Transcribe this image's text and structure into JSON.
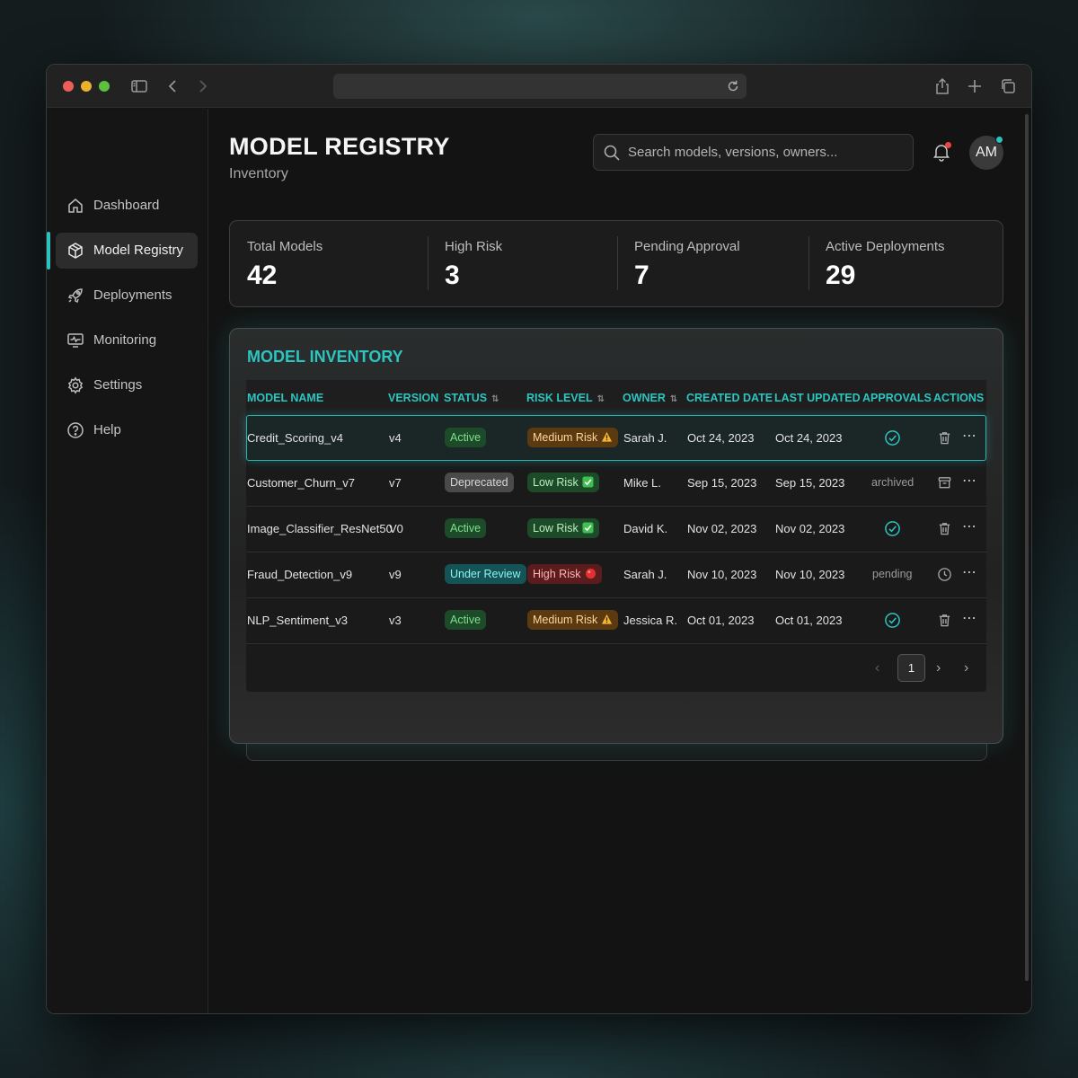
{
  "header": {
    "title": "MODEL REGISTRY",
    "subtitle": "Inventory"
  },
  "search": {
    "placeholder": "Search models, versions, owners..."
  },
  "user": {
    "initials": "AM"
  },
  "sidebar": {
    "items": [
      {
        "label": "Dashboard",
        "icon": "home-icon"
      },
      {
        "label": "Model Registry",
        "icon": "cube-icon",
        "active": true
      },
      {
        "label": "Deployments",
        "icon": "rocket-icon"
      },
      {
        "label": "Monitoring",
        "icon": "monitor-icon"
      },
      {
        "label": "Settings",
        "icon": "gear-icon"
      },
      {
        "label": "Help",
        "icon": "help-icon"
      }
    ]
  },
  "stats": [
    {
      "label": "Total Models",
      "value": "42"
    },
    {
      "label": "High Risk",
      "value": "3"
    },
    {
      "label": "Pending Approval",
      "value": "7"
    },
    {
      "label": "Active Deployments",
      "value": "29"
    }
  ],
  "inventory": {
    "title": "MODEL INVENTORY",
    "columns": {
      "model_name": "MODEL NAME",
      "version": "VERSION",
      "status": "STATUS",
      "risk_level": "RISK LEVEL",
      "owner": "OWNER",
      "created_date": "CREATED DATE",
      "last_updated": "LAST UPDATED",
      "approvals": "APPROVALS",
      "actions": "ACTIONS"
    },
    "rows": [
      {
        "name": "Credit_Scoring_v4",
        "version": "v4",
        "status": "Active",
        "risk": "Medium Risk",
        "owner": "Sarah J.",
        "created": "Oct 24, 2023",
        "updated": "Oct 24, 2023",
        "approval": "approved"
      },
      {
        "name": "Customer_Churn_v7",
        "version": "v7",
        "status": "Deprecated",
        "risk": "Low Risk",
        "owner": "Mike L.",
        "created": "Sep 15, 2023",
        "updated": "Sep 15, 2023",
        "approval": "archived"
      },
      {
        "name": "Image_Classifier_ResNet50",
        "version": "V0",
        "status": "Active",
        "risk": "Low Risk",
        "owner": "David K.",
        "created": "Nov 02, 2023",
        "updated": "Nov 02, 2023",
        "approval": "approved"
      },
      {
        "name": "Fraud_Detection_v9",
        "version": "v9",
        "status": "Under Review",
        "risk": "High Risk",
        "owner": "Sarah J.",
        "created": "Nov 10, 2023",
        "updated": "Nov 10, 2023",
        "approval": "pending"
      },
      {
        "name": "NLP_Sentiment_v3",
        "version": "v3",
        "status": "Active",
        "risk": "Medium Risk",
        "owner": "Jessica R.",
        "created": "Oct 01, 2023",
        "updated": "Oct 01, 2023",
        "approval": "approved"
      }
    ],
    "pagination": {
      "current_page": "1"
    }
  },
  "colors": {
    "accent": "#2ec4c0",
    "status_active": "#1d4a28",
    "status_review": "#145457",
    "risk_medium": "#5b3a12",
    "risk_high": "#5a1c1c"
  }
}
